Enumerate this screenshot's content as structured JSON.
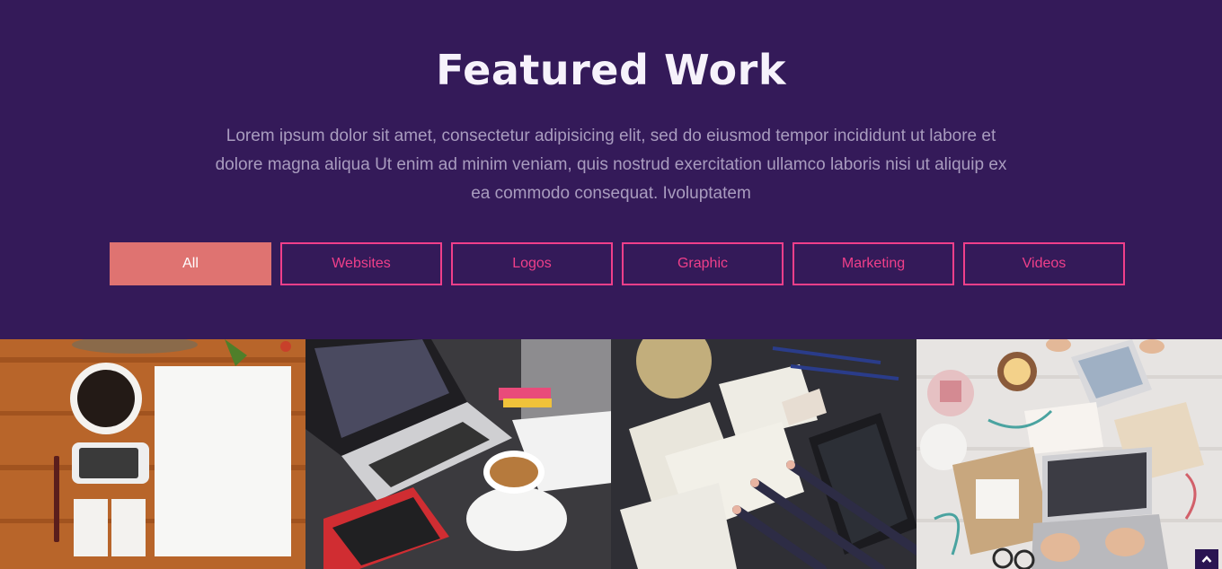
{
  "section": {
    "title": "Featured Work",
    "intro": "Lorem ipsum dolor sit amet, consectetur adipisicing elit, sed do eiusmod tempor incididunt ut labore et dolore magna aliqua Ut enim ad minim veniam, quis nostrud exercitation ullamco laboris nisi ut aliquip ex ea commodo consequat. Ivoluptatem"
  },
  "filters": [
    {
      "label": "All",
      "active": true
    },
    {
      "label": "Websites",
      "active": false
    },
    {
      "label": "Logos",
      "active": false
    },
    {
      "label": "Graphic",
      "active": false
    },
    {
      "label": "Marketing",
      "active": false
    },
    {
      "label": "Videos",
      "active": false
    }
  ],
  "gallery": [
    {
      "subject": "stationery mockup with coffee cup, phone and blank paper on wood desk"
    },
    {
      "subject": "laptop with coffee cup and phone on dark desk"
    },
    {
      "subject": "wireframe sketches with pencils and smartphone on dark desk"
    },
    {
      "subject": "hands typing on laptop with tea and craft supplies on white wood"
    }
  ],
  "icons": {
    "scroll_top": "chevron-up-icon"
  },
  "colors": {
    "background": "#341a59",
    "accent": "#f03f8a",
    "active_filter": "#df7371",
    "title": "#f6f2fb",
    "intro": "#a99cbf"
  }
}
